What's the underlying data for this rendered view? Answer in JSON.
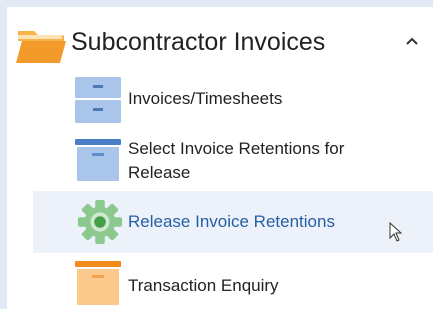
{
  "section": {
    "title": "Subcontractor Invoices",
    "icon": "folder-icon",
    "toggle_icon": "chevron-up-icon",
    "expanded": true
  },
  "items": [
    {
      "label_lines": [
        "Invoices/Timesheets"
      ],
      "icon": "filing-cabinet-icon",
      "active": false
    },
    {
      "label_lines": [
        "Select Invoice Retentions for",
        "Release"
      ],
      "icon": "archive-box-icon",
      "active": false
    },
    {
      "label_lines": [
        "Release Invoice Retentions"
      ],
      "icon": "gear-icon",
      "active": true
    },
    {
      "label_lines": [
        "Transaction Enquiry"
      ],
      "icon": "archive-box-icon",
      "active": false
    }
  ],
  "colors": {
    "background": "#e3e9f4",
    "panel": "#ffffff",
    "hover_row": "#edf2fa",
    "active_text": "#245fa5",
    "folder": "#f29b2b",
    "blue_icon": "#a9c5ea",
    "green_icon": "#66bb6a",
    "orange_icon": "#f5a052"
  }
}
